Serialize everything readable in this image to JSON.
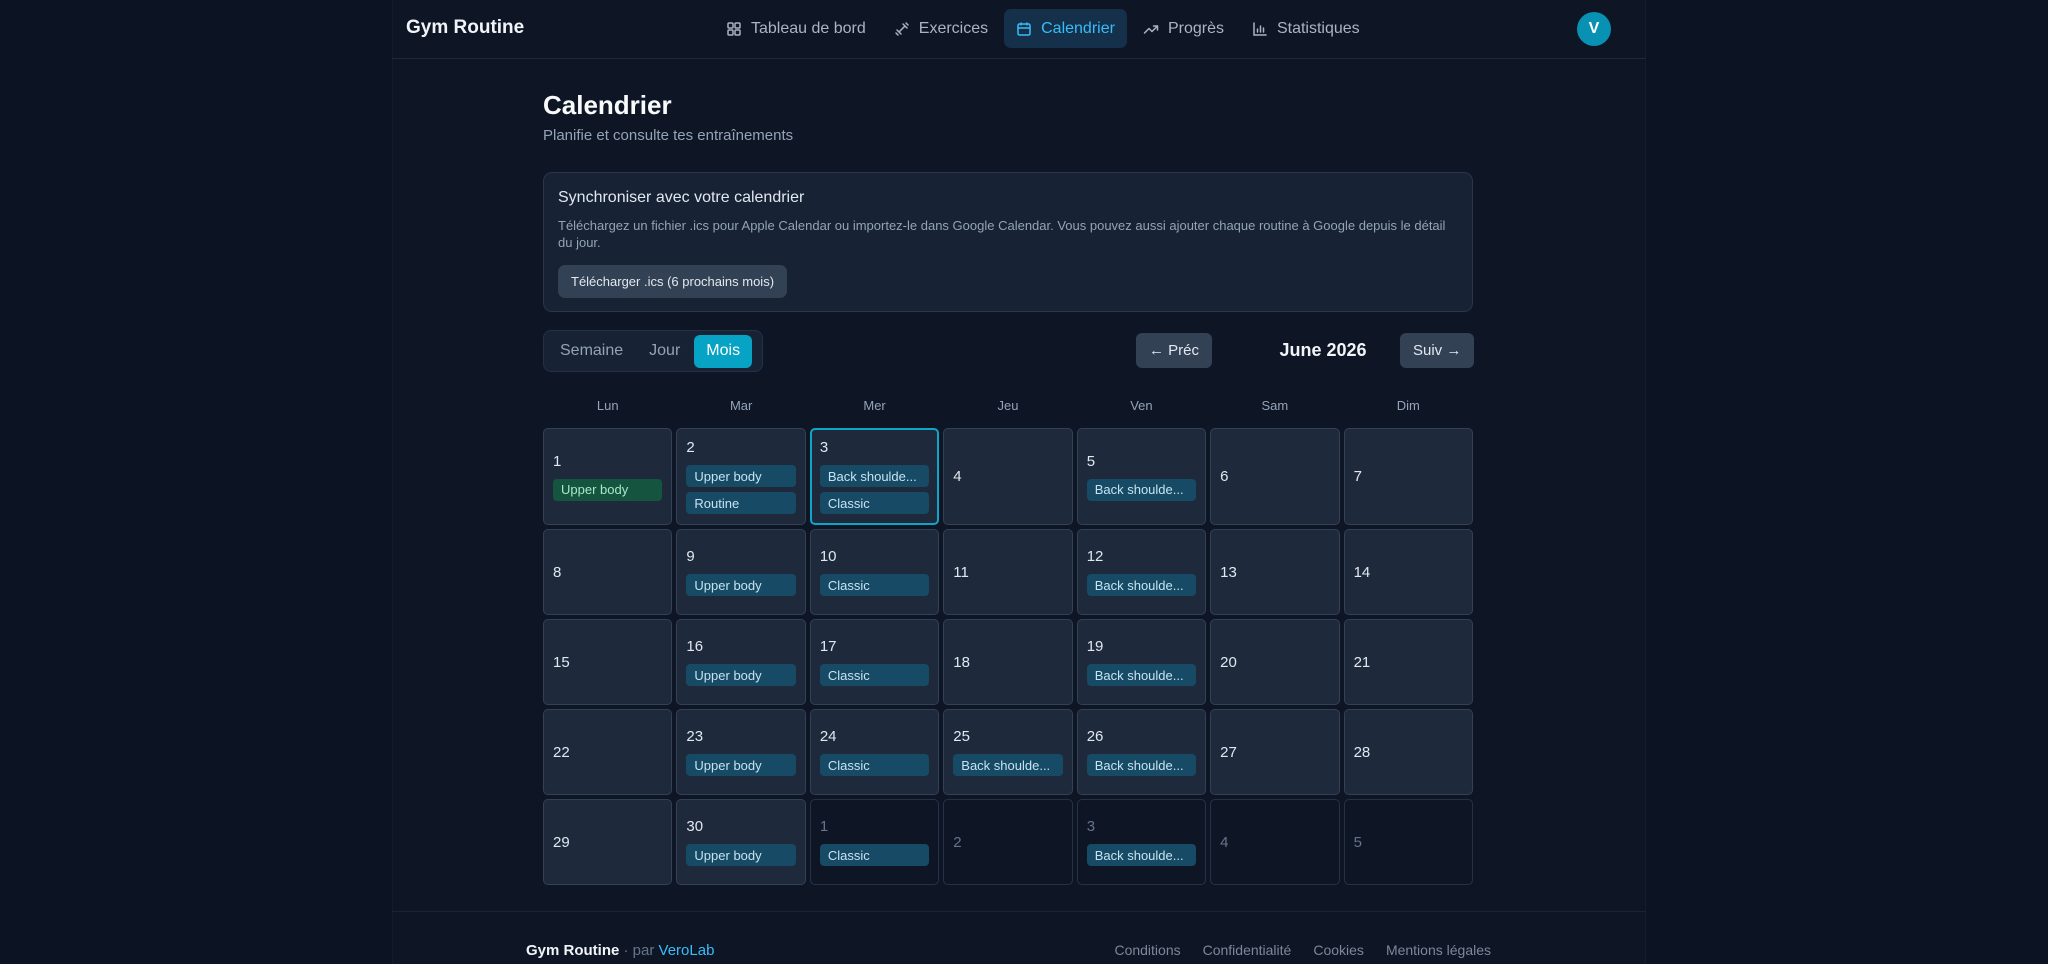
{
  "app": {
    "title": "Gym Routine",
    "avatar_initial": "V"
  },
  "nav": {
    "items": [
      {
        "label": "Tableau de bord",
        "icon": "dashboard-icon"
      },
      {
        "label": "Exercices",
        "icon": "dumbbell-icon"
      },
      {
        "label": "Calendrier",
        "icon": "calendar-icon",
        "active": true
      },
      {
        "label": "Progrès",
        "icon": "trending-up-icon"
      },
      {
        "label": "Statistiques",
        "icon": "bar-chart-icon"
      }
    ]
  },
  "page": {
    "title": "Calendrier",
    "subtitle": "Planifie et consulte tes entraînements"
  },
  "sync": {
    "title": "Synchroniser avec votre calendrier",
    "description": "Téléchargez un fichier .ics pour Apple Calendar ou importez-le dans Google Calendar. Vous pouvez aussi ajouter chaque routine à Google depuis le détail du jour.",
    "button_label": "Télécharger .ics (6 prochains mois)"
  },
  "view_toggle": {
    "week": "Semaine",
    "day": "Jour",
    "month": "Mois",
    "active": "month"
  },
  "calendar": {
    "prev_label": "← Préc",
    "next_label": "Suiv →",
    "month_label": "June 2026",
    "weekdays": [
      "Lun",
      "Mar",
      "Mer",
      "Jeu",
      "Ven",
      "Sam",
      "Dim"
    ],
    "days": [
      {
        "day": "1",
        "events": [
          {
            "label": "Upper body",
            "style": "green"
          }
        ]
      },
      {
        "day": "2",
        "events": [
          {
            "label": "Upper body"
          },
          {
            "label": "Routine"
          }
        ]
      },
      {
        "day": "3",
        "today": true,
        "events": [
          {
            "label": "Back shoulde..."
          },
          {
            "label": "Classic"
          }
        ]
      },
      {
        "day": "4",
        "events": []
      },
      {
        "day": "5",
        "events": [
          {
            "label": "Back shoulde..."
          }
        ]
      },
      {
        "day": "6",
        "events": []
      },
      {
        "day": "7",
        "events": []
      },
      {
        "day": "8",
        "events": []
      },
      {
        "day": "9",
        "events": [
          {
            "label": "Upper body"
          }
        ]
      },
      {
        "day": "10",
        "events": [
          {
            "label": "Classic"
          }
        ]
      },
      {
        "day": "11",
        "events": []
      },
      {
        "day": "12",
        "events": [
          {
            "label": "Back shoulde..."
          }
        ]
      },
      {
        "day": "13",
        "events": []
      },
      {
        "day": "14",
        "events": []
      },
      {
        "day": "15",
        "events": []
      },
      {
        "day": "16",
        "events": [
          {
            "label": "Upper body"
          }
        ]
      },
      {
        "day": "17",
        "events": [
          {
            "label": "Classic"
          }
        ]
      },
      {
        "day": "18",
        "events": []
      },
      {
        "day": "19",
        "events": [
          {
            "label": "Back shoulde..."
          }
        ]
      },
      {
        "day": "20",
        "events": []
      },
      {
        "day": "21",
        "events": []
      },
      {
        "day": "22",
        "events": []
      },
      {
        "day": "23",
        "events": [
          {
            "label": "Upper body"
          }
        ]
      },
      {
        "day": "24",
        "events": [
          {
            "label": "Classic"
          }
        ]
      },
      {
        "day": "25",
        "events": [
          {
            "label": "Back shoulde..."
          }
        ]
      },
      {
        "day": "26",
        "events": [
          {
            "label": "Back shoulde..."
          }
        ]
      },
      {
        "day": "27",
        "events": []
      },
      {
        "day": "28",
        "events": []
      },
      {
        "day": "29",
        "events": []
      },
      {
        "day": "30",
        "events": [
          {
            "label": "Upper body"
          }
        ]
      },
      {
        "day": "1",
        "outside": true,
        "events": [
          {
            "label": "Classic"
          }
        ]
      },
      {
        "day": "2",
        "outside": true,
        "events": []
      },
      {
        "day": "3",
        "outside": true,
        "events": [
          {
            "label": "Back shoulde..."
          }
        ]
      },
      {
        "day": "4",
        "outside": true,
        "events": []
      },
      {
        "day": "5",
        "outside": true,
        "events": []
      }
    ]
  },
  "footer": {
    "brand": "Gym Routine",
    "by": "· par",
    "author": "VeroLab",
    "links": [
      "Conditions",
      "Confidentialité",
      "Cookies",
      "Mentions légales"
    ]
  },
  "colors": {
    "accent": "#06a3c4",
    "active_nav": "#38bdf8",
    "event_chip": "#164a65",
    "event_chip_green": "#15543f"
  }
}
